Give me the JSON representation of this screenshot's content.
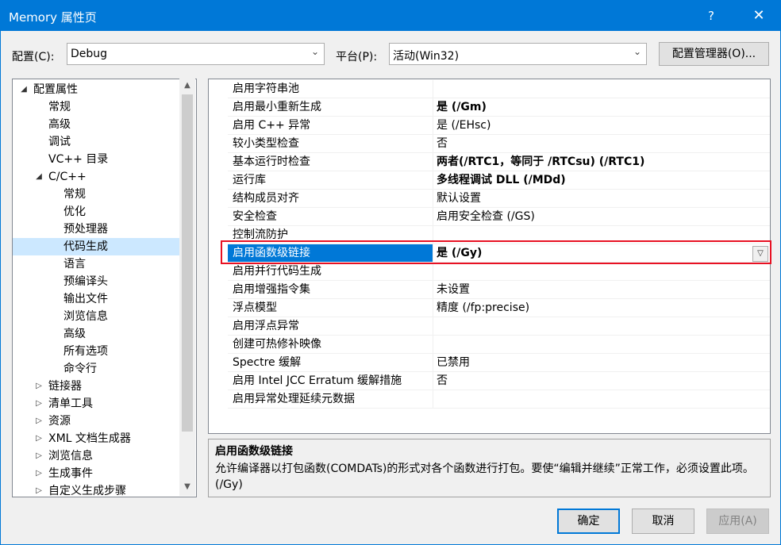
{
  "window": {
    "title": "Memory 属性页",
    "help": "?",
    "close": "✕"
  },
  "toolbar": {
    "config_label": "配置(C):",
    "config_value": "Debug",
    "platform_label": "平台(P):",
    "platform_value": "活动(Win32)",
    "config_manager": "配置管理器(O)..."
  },
  "tree": {
    "items": [
      {
        "label": "配置属性",
        "expander": "◢"
      },
      {
        "label": "常规"
      },
      {
        "label": "高级"
      },
      {
        "label": "调试"
      },
      {
        "label": "VC++ 目录"
      },
      {
        "label": "C/C++",
        "expander": "◢"
      },
      {
        "label": "常规"
      },
      {
        "label": "优化"
      },
      {
        "label": "预处理器"
      },
      {
        "label": "代码生成",
        "selected": true
      },
      {
        "label": "语言"
      },
      {
        "label": "预编译头"
      },
      {
        "label": "输出文件"
      },
      {
        "label": "浏览信息"
      },
      {
        "label": "高级"
      },
      {
        "label": "所有选项"
      },
      {
        "label": "命令行"
      },
      {
        "label": "链接器",
        "expander": "▷"
      },
      {
        "label": "清单工具",
        "expander": "▷"
      },
      {
        "label": "资源",
        "expander": "▷"
      },
      {
        "label": "XML 文档生成器",
        "expander": "▷"
      },
      {
        "label": "浏览信息",
        "expander": "▷"
      },
      {
        "label": "生成事件",
        "expander": "▷"
      },
      {
        "label": "自定义生成步骤",
        "expander": "▷"
      }
    ]
  },
  "properties": [
    {
      "name": "启用字符串池",
      "value": ""
    },
    {
      "name": "启用最小重新生成",
      "value": "是 (/Gm)",
      "bold": true
    },
    {
      "name": "启用 C++ 异常",
      "value": "是 (/EHsc)"
    },
    {
      "name": "较小类型检查",
      "value": "否"
    },
    {
      "name": "基本运行时检查",
      "value": "两者(/RTC1，等同于 /RTCsu) (/RTC1)",
      "bold": true
    },
    {
      "name": "运行库",
      "value": "多线程调试 DLL (/MDd)",
      "bold": true
    },
    {
      "name": "结构成员对齐",
      "value": "默认设置"
    },
    {
      "name": "安全检查",
      "value": "启用安全检查 (/GS)"
    },
    {
      "name": "控制流防护",
      "value": ""
    },
    {
      "name": "启用函数级链接",
      "value": "是 (/Gy)",
      "selected": true
    },
    {
      "name": "启用并行代码生成",
      "value": ""
    },
    {
      "name": "启用增强指令集",
      "value": "未设置"
    },
    {
      "name": "浮点模型",
      "value": "精度 (/fp:precise)"
    },
    {
      "name": "启用浮点异常",
      "value": ""
    },
    {
      "name": "创建可热修补映像",
      "value": ""
    },
    {
      "name": "Spectre 缓解",
      "value": "已禁用"
    },
    {
      "name": "启用 Intel JCC Erratum 缓解措施",
      "value": "否"
    },
    {
      "name": "启用异常处理延续元数据",
      "value": ""
    }
  ],
  "description": {
    "title": "启用函数级链接",
    "text": "允许编译器以打包函数(COMDATs)的形式对各个函数进行打包。要使“编辑并继续”正常工作，必须设置此项。     (/Gy)"
  },
  "buttons": {
    "ok": "确定",
    "cancel": "取消",
    "apply": "应用(A)"
  },
  "colors": {
    "accent": "#0078d7",
    "highlight_border": "#e81123",
    "tree_selected": "#cce8ff"
  }
}
